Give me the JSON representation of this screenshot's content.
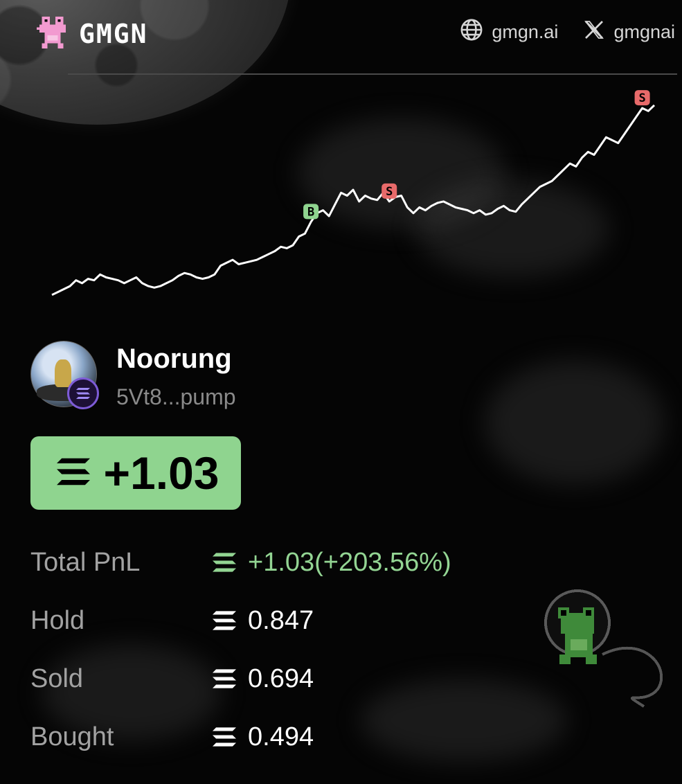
{
  "brand": {
    "name": "GMGN"
  },
  "header": {
    "links": [
      {
        "icon": "globe-icon",
        "label": "gmgn.ai"
      },
      {
        "icon": "x-logo-icon",
        "label": "gmgnai"
      }
    ]
  },
  "colors": {
    "profit": "#8fd48f",
    "buy_marker": "#8fd48f",
    "sell_marker": "#e86a6a",
    "line": "#ffffff"
  },
  "chart_data": {
    "type": "line",
    "x": [
      0,
      1,
      2,
      3,
      4,
      5,
      6,
      7,
      8,
      9,
      10,
      11,
      12,
      13,
      14,
      15,
      16,
      17,
      18,
      19,
      20,
      21,
      22,
      23,
      24,
      25,
      26,
      27,
      28,
      29,
      30,
      31,
      32,
      33,
      34,
      35,
      36,
      37,
      38,
      39,
      40,
      41,
      42,
      43,
      44,
      45,
      46,
      47,
      48,
      49,
      50,
      51,
      52,
      53,
      54,
      55,
      56,
      57,
      58,
      59,
      60,
      61,
      62,
      63,
      64,
      65,
      66,
      67,
      68,
      69,
      70,
      71,
      72,
      73,
      74,
      75,
      76,
      77,
      78,
      79,
      80,
      81,
      82,
      83,
      84,
      85,
      86,
      87,
      88,
      89,
      90,
      91,
      92,
      93,
      94,
      95,
      96,
      97,
      98,
      99,
      100
    ],
    "values": [
      2,
      4,
      6,
      8,
      12,
      10,
      13,
      12,
      16,
      14,
      13,
      12,
      10,
      12,
      14,
      10,
      8,
      7,
      8,
      10,
      12,
      15,
      17,
      16,
      14,
      13,
      14,
      16,
      22,
      24,
      26,
      23,
      24,
      25,
      26,
      28,
      30,
      32,
      35,
      34,
      36,
      42,
      44,
      52,
      58,
      60,
      56,
      64,
      72,
      70,
      74,
      66,
      70,
      68,
      67,
      72,
      66,
      69,
      70,
      62,
      58,
      62,
      60,
      63,
      65,
      66,
      64,
      62,
      61,
      60,
      58,
      60,
      57,
      58,
      61,
      63,
      60,
      59,
      64,
      68,
      72,
      76,
      78,
      80,
      84,
      88,
      92,
      90,
      96,
      100,
      98,
      104,
      110,
      108,
      106,
      112,
      118,
      124,
      130,
      128,
      132
    ],
    "markers": [
      {
        "index": 43,
        "label": "B"
      },
      {
        "index": 56,
        "label": "S"
      },
      {
        "index": 98,
        "label": "S"
      }
    ],
    "ylim": [
      0,
      140
    ]
  },
  "profile": {
    "name": "Noorung",
    "address": "5Vt8...pump"
  },
  "pnl_box": {
    "value": "+1.03"
  },
  "stats": [
    {
      "label": "Total PnL",
      "value": "+1.03(+203.56%)",
      "highlight": true
    },
    {
      "label": "Hold",
      "value": "0.847",
      "highlight": false
    },
    {
      "label": "Sold",
      "value": "0.694",
      "highlight": false
    },
    {
      "label": "Bought",
      "value": "0.494",
      "highlight": false
    }
  ]
}
